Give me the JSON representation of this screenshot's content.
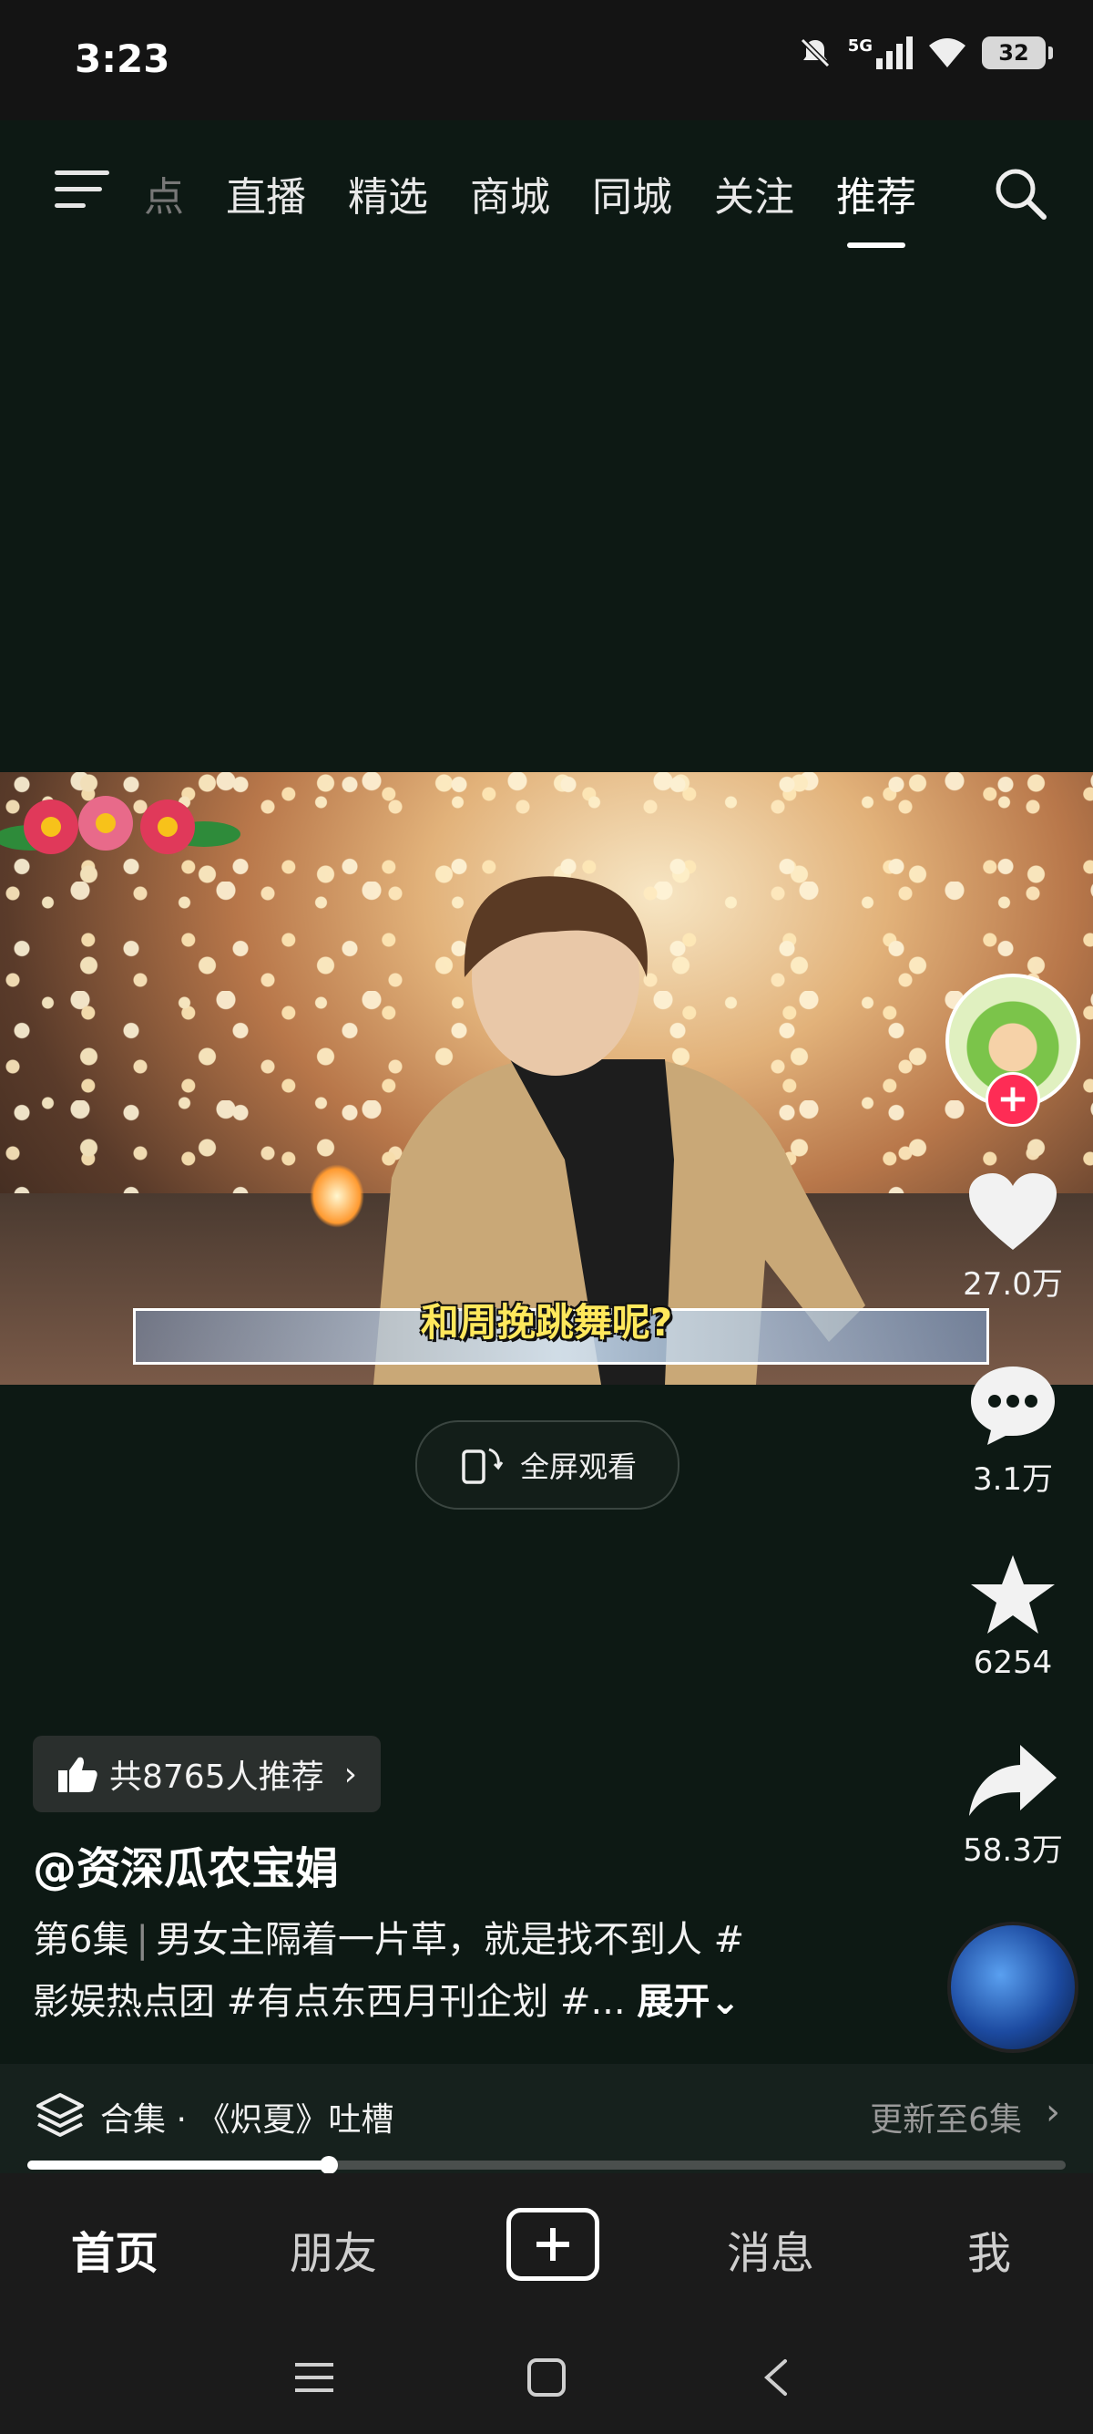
{
  "status_bar": {
    "time": "3:23",
    "network": "5G",
    "battery": "32"
  },
  "top_nav": {
    "tabs": [
      {
        "label": "点",
        "state": "partially-visible"
      },
      {
        "label": "直播"
      },
      {
        "label": "精选"
      },
      {
        "label": "商城"
      },
      {
        "label": "同城"
      },
      {
        "label": "关注"
      },
      {
        "label": "推荐",
        "state": "active"
      }
    ],
    "menu_icon": "menu-icon",
    "search_icon": "search-icon"
  },
  "video": {
    "subtitle": "和周挽跳舞呢?"
  },
  "fullscreen": {
    "label": "全屏观看",
    "icon": "rotate-phone-icon"
  },
  "rail": {
    "likes": "27.0万",
    "comments": "3.1万",
    "favorites": "6254",
    "shares": "58.3万"
  },
  "recommend": {
    "label": "共8765人推荐"
  },
  "post": {
    "username": "@资深瓜农宝娟",
    "episode": "第6集",
    "desc_line1": "男女主隔着一片草，就是找不到人 #",
    "desc_line2": "影娱热点团 #有点东西月刊企划 #...",
    "expand": "展开"
  },
  "collection": {
    "title": "合集 · 《炽夏》吐槽",
    "update": "更新至6集"
  },
  "playback": {
    "progress": 0.29
  },
  "bottom_nav": {
    "home": "首页",
    "friends": "朋友",
    "messages": "消息",
    "me": "我"
  },
  "colors": {
    "background": "#0d1914",
    "follow_red": "#fe2c55",
    "subtitle_yellow": "#ffe85c"
  }
}
